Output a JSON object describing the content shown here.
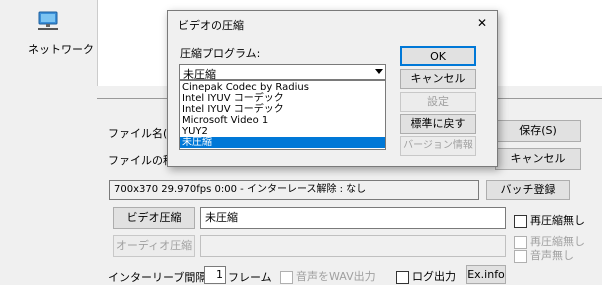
{
  "desktop": {
    "network_label": "ネットワーク"
  },
  "main": {
    "file_name_label": "ファイル名(N)",
    "file_type_label": "ファイルの種類",
    "save_label": "保存(S)",
    "cancel_label": "キャンセル",
    "info_text": "700x370  29.970fps  0:00  -  インターレース解除 : なし",
    "batch_label": "バッチ登録",
    "video_compress_label": "ビデオ圧縮",
    "video_codec_value": "未圧縮",
    "no_recompress_label": "再圧縮無し",
    "audio_compress_label": "オーディオ圧縮",
    "audio_no_recompress_label": "再圧縮無し",
    "no_audio_label": "音声無し",
    "interleave_label": "インターリーブ間隔：",
    "interleave_value": "1",
    "interleave_unit": "フレーム",
    "wav_output_label": "音声をWAV出力",
    "log_output_label": "ログ出力",
    "exinfo_label": "Ex.info"
  },
  "dialog": {
    "title": "ビデオの圧縮",
    "close_glyph": "✕",
    "program_label": "圧縮プログラム:",
    "selected": "未圧縮",
    "options": [
      "Cinepak Codec by Radius",
      "Intel IYUV コーデック",
      "Intel IYUV コーデック",
      "Microsoft Video 1",
      "YUY2",
      "未圧縮"
    ],
    "ok_label": "OK",
    "cancel_label": "キャンセル",
    "configure_label": "設定",
    "default_label": "標準に戻す",
    "version_label": "バージョン情報"
  }
}
